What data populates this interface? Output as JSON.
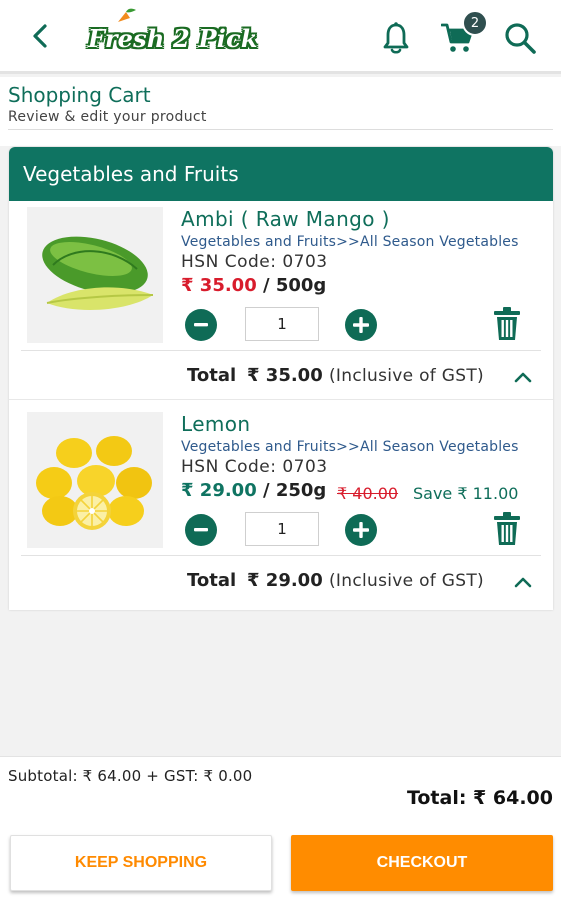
{
  "header": {
    "logo_text": "Fresh 2 Pick",
    "cart_count": "2",
    "icons": [
      "back-arrow-icon",
      "bell-icon",
      "cart-icon",
      "search-icon"
    ]
  },
  "page": {
    "title": "Shopping Cart",
    "subtitle": "Review & edit your product"
  },
  "section": {
    "title": "Vegetables and Fruits"
  },
  "items": [
    {
      "name": "Ambi ( Raw Mango )",
      "category": "Vegetables and Fruits>>All Season Vegetables",
      "hsn": "HSN Code: 0703",
      "price": "₹ 35.00",
      "unit": " / 500g",
      "mrp": "",
      "save": "",
      "qty": "1",
      "total_label": "Total",
      "total_amount": "₹ 35.00",
      "gst_note": "(Inclusive of GST)"
    },
    {
      "name": "Lemon",
      "category": "Vegetables and Fruits>>All Season Vegetables",
      "hsn": "HSN Code: 0703",
      "price": "₹ 29.00",
      "unit": " / 250g",
      "mrp": "₹ 40.00",
      "save": "Save ₹ 11.00",
      "qty": "1",
      "total_label": "Total",
      "total_amount": "₹ 29.00",
      "gst_note": "(Inclusive of GST)"
    }
  ],
  "summary": {
    "subtotal": "Subtotal: ₹ 64.00 + GST: ₹ 0.00",
    "total": "Total: ₹ 64.00"
  },
  "buttons": {
    "keep_shopping": "KEEP SHOPPING",
    "checkout": "CHECKOUT"
  },
  "colors": {
    "brand_green": "#0f7462",
    "price_red": "#d81c2c",
    "accent_orange": "#ff8c00"
  }
}
